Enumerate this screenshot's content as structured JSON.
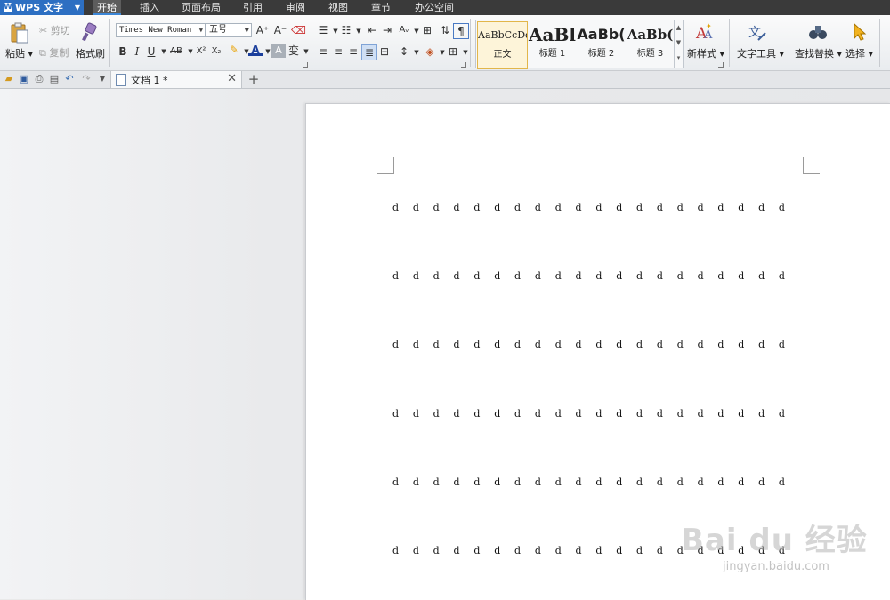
{
  "app": {
    "name": "WPS 文字"
  },
  "menu_tabs": [
    "开始",
    "插入",
    "页面布局",
    "引用",
    "审阅",
    "视图",
    "章节",
    "办公空间"
  ],
  "ribbon": {
    "paste": "粘贴",
    "cut": "剪切",
    "copy": "复制",
    "format_painter": "格式刷",
    "font_name": "Times New Roman",
    "font_size": "五号",
    "styles": [
      {
        "sample": "AaBbCcDd",
        "label": "正文"
      },
      {
        "sample": "AaBl",
        "label": "标题 1"
      },
      {
        "sample": "AaBb(",
        "label": "标题 2"
      },
      {
        "sample": "AaBb(",
        "label": "标题 3"
      }
    ],
    "new_style": "新样式",
    "text_tools": "文字工具",
    "find_replace": "查找替换",
    "select": "选择",
    "glyphs": {
      "bold": "B",
      "italic": "I",
      "underline": "U",
      "strike": "AB",
      "superscript": "X²",
      "subscript": "X₂",
      "font_color": "A",
      "char_shade": "A",
      "phonetic": "变",
      "grow_font": "A⁺",
      "shrink_font": "A⁻"
    }
  },
  "document_tab": {
    "title": "文档 1 *"
  },
  "document": {
    "lines": [
      "d d d d d d d d d d d d d d d d d d d d",
      "d d d d d d d d d d d d d d d d d d d d",
      "d d d d d d d d d d d d d d d d d d d d",
      "d d d d d d d d d d d d d d d d d d d d",
      "d d d d d d d d d d d d d d d d d d d d",
      "d d d d d d d d d d d d d d d d d d d d"
    ]
  },
  "watermark": {
    "logo": "Bai du 经验",
    "url": "jingyan.baidu.com"
  }
}
